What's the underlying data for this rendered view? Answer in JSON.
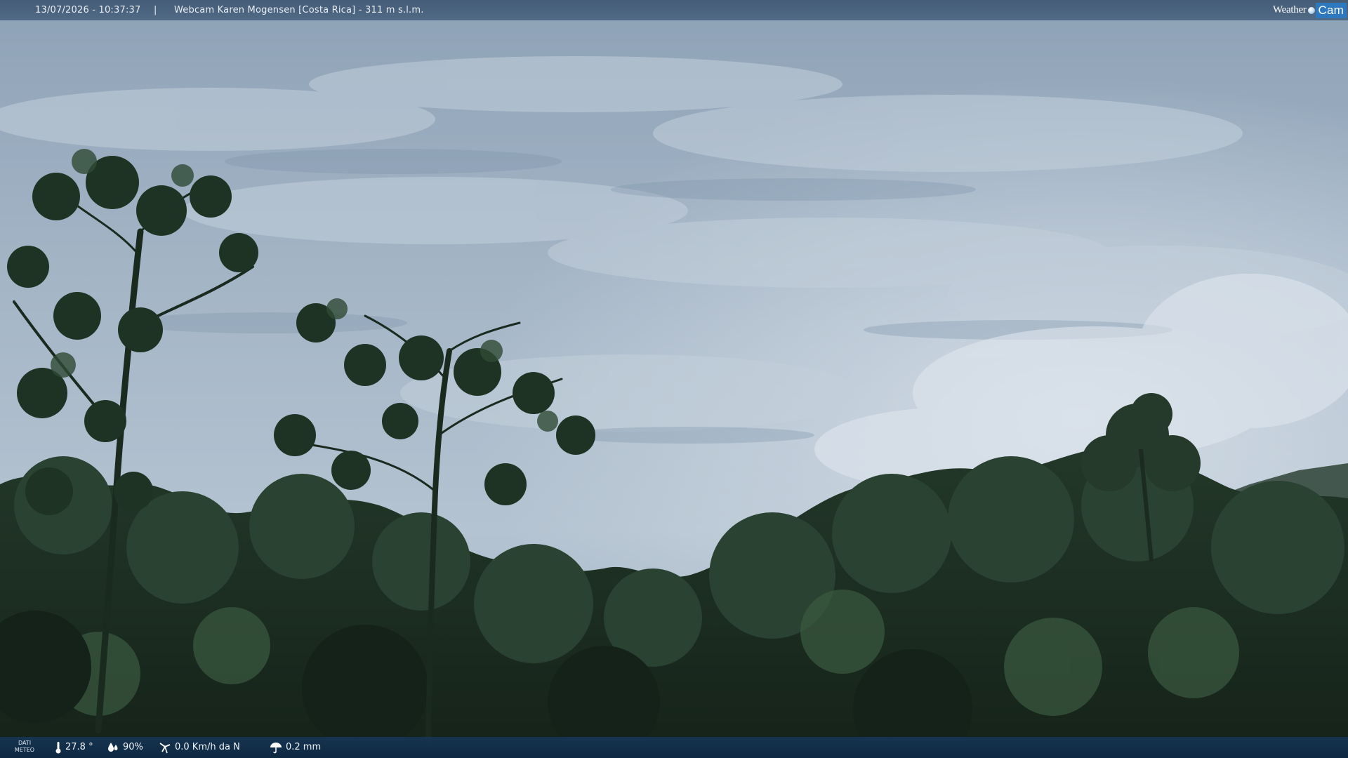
{
  "overlay": {
    "timestamp": "13/07/2026 - 10:37:37",
    "separator": "|",
    "caption": "Webcam Karen Mogensen [Costa Rica]  - 311 m s.l.m.",
    "brand_part1": "Weather",
    "brand_part2": "Cam"
  },
  "weather": {
    "label_line1": "DATI",
    "label_line2": "METEO",
    "temperature": "27.8 °",
    "humidity": "90%",
    "wind": "0.0 Km/h da N",
    "rain": "0.2 mm"
  },
  "colors": {
    "top_bar": "#41597a",
    "bottom_bar": "#163656",
    "brand_accent": "#2e78bf",
    "sky": "#a9b9c8",
    "foliage": "#1d2e22"
  },
  "icons": {
    "temperature": "thermometer-icon",
    "humidity": "humidity-drop-icon",
    "wind": "wind-turbine-icon",
    "rain": "umbrella-icon"
  }
}
